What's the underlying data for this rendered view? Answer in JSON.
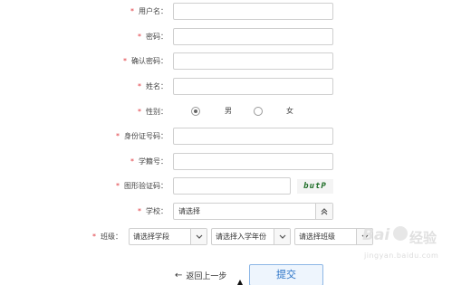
{
  "required_mark": "*",
  "fields": {
    "username": {
      "label": "用户名：",
      "value": ""
    },
    "password": {
      "label": "密码：",
      "value": ""
    },
    "confirm_password": {
      "label": "确认密码：",
      "value": ""
    },
    "name": {
      "label": "姓名：",
      "value": ""
    },
    "gender": {
      "label": "性别：",
      "options": [
        "男",
        "女"
      ],
      "selected": "男"
    },
    "id_number": {
      "label": "身份证号码：",
      "value": ""
    },
    "student_id": {
      "label": "学籍号：",
      "value": ""
    },
    "captcha": {
      "label": "图形验证码：",
      "value": "",
      "image_text": "butP"
    },
    "school": {
      "label": "学校：",
      "value": "请选择"
    },
    "class": {
      "label": "班级：",
      "selects": [
        "请选择学段",
        "请选择入学年份",
        "请选择班级"
      ]
    }
  },
  "actions": {
    "back_label": "返回上一步",
    "back_arrow": "←",
    "submit_label": "提交"
  },
  "watermark": {
    "logo": "Bai",
    "logo_suffix": "经验",
    "url": "jingyan.baidu.com"
  },
  "icons": {
    "school_button": "expand-up-icon",
    "select_button": "chevron-down-icon",
    "back": "arrow-left-icon"
  }
}
